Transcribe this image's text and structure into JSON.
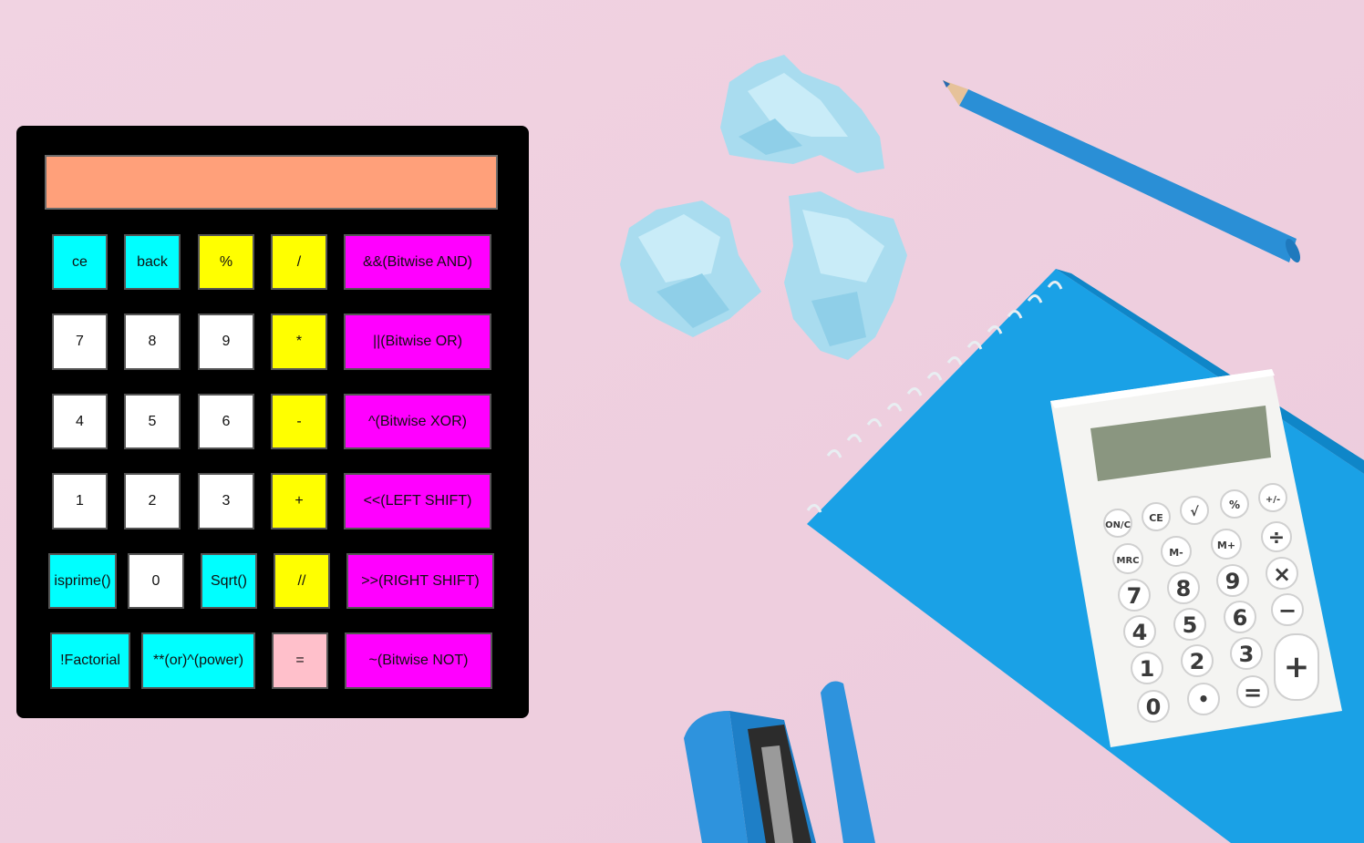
{
  "display": {
    "value": ""
  },
  "keys": {
    "ce": "ce",
    "back": "back",
    "percent": "%",
    "divide": "/",
    "bitwise_and": "&&(Bitwise AND)",
    "seven": "7",
    "eight": "8",
    "nine": "9",
    "multiply": "*",
    "bitwise_or": "||(Bitwise OR)",
    "four": "4",
    "five": "5",
    "six": "6",
    "minus": "-",
    "bitwise_xor": "^(Bitwise XOR)",
    "one": "1",
    "two": "2",
    "three": "3",
    "plus": "+",
    "left_shift": "<<(LEFT SHIFT)",
    "isprime": "isprime()",
    "zero": "0",
    "sqrt": "Sqrt()",
    "floor_divide": "//",
    "right_shift": ">>(RIGHT SHIFT)",
    "factorial": "!Factorial",
    "power": "**(or)^(power)",
    "equals": "=",
    "bitwise_not": "~(Bitwise NOT)"
  },
  "colors": {
    "display": "#ffa07a",
    "function_key": "#00ffff",
    "digit_key": "#ffffff",
    "operator_key": "#ffff00",
    "bitwise_key": "#ff00ff",
    "equals_key": "#ffc0cb",
    "page_background": "#efcfe0"
  },
  "background_photo": {
    "description_icons": [
      "crumpled-paper-icon",
      "pencil-icon",
      "notebook-icon",
      "calculator-icon",
      "stapler-icon"
    ],
    "calc_keys": [
      [
        "ON/C",
        "CE",
        "√",
        "%",
        "+/-"
      ],
      [
        "MRC",
        "M-",
        "M+",
        "÷"
      ],
      [
        "7",
        "8",
        "9",
        "×"
      ],
      [
        "4",
        "5",
        "6",
        "−"
      ],
      [
        "1",
        "2",
        "3",
        "+"
      ],
      [
        "0",
        "•",
        "="
      ]
    ]
  }
}
